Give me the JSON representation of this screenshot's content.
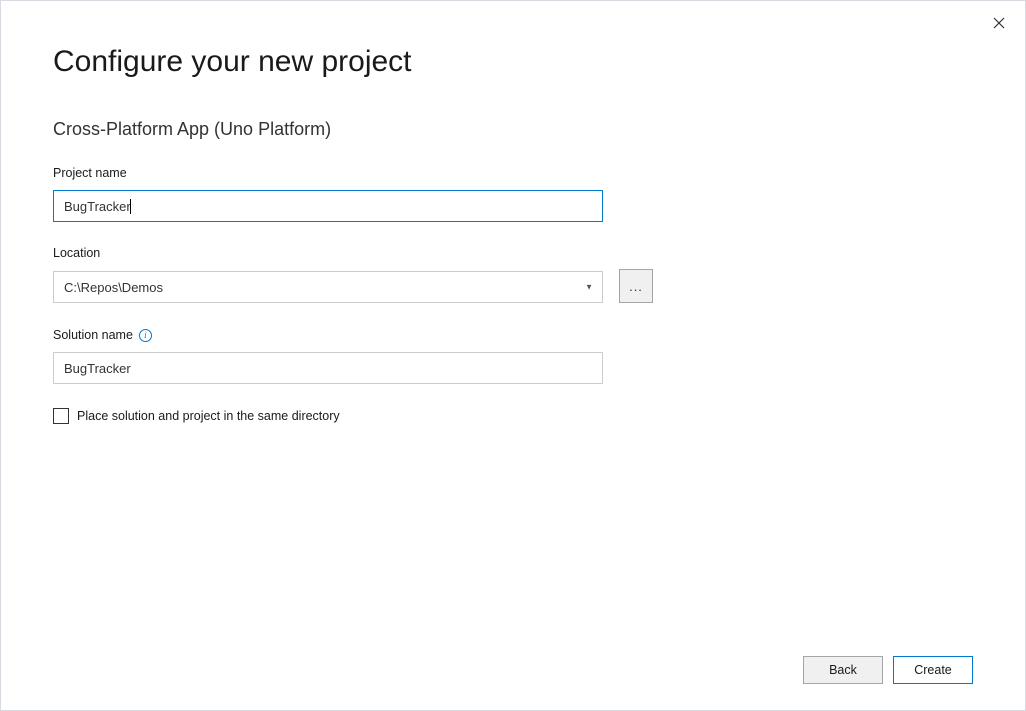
{
  "close_label": "Close",
  "page_title": "Configure your new project",
  "template_name": "Cross-Platform App (Uno Platform)",
  "fields": {
    "project_name": {
      "label": "Project name",
      "value": "BugTracker"
    },
    "location": {
      "label": "Location",
      "value": "C:\\Repos\\Demos",
      "browse_label": "..."
    },
    "solution_name": {
      "label": "Solution name",
      "value": "BugTracker",
      "info_tooltip": "i"
    }
  },
  "checkbox": {
    "label": "Place solution and project in the same directory",
    "checked": false
  },
  "buttons": {
    "back": "Back",
    "create": "Create"
  }
}
